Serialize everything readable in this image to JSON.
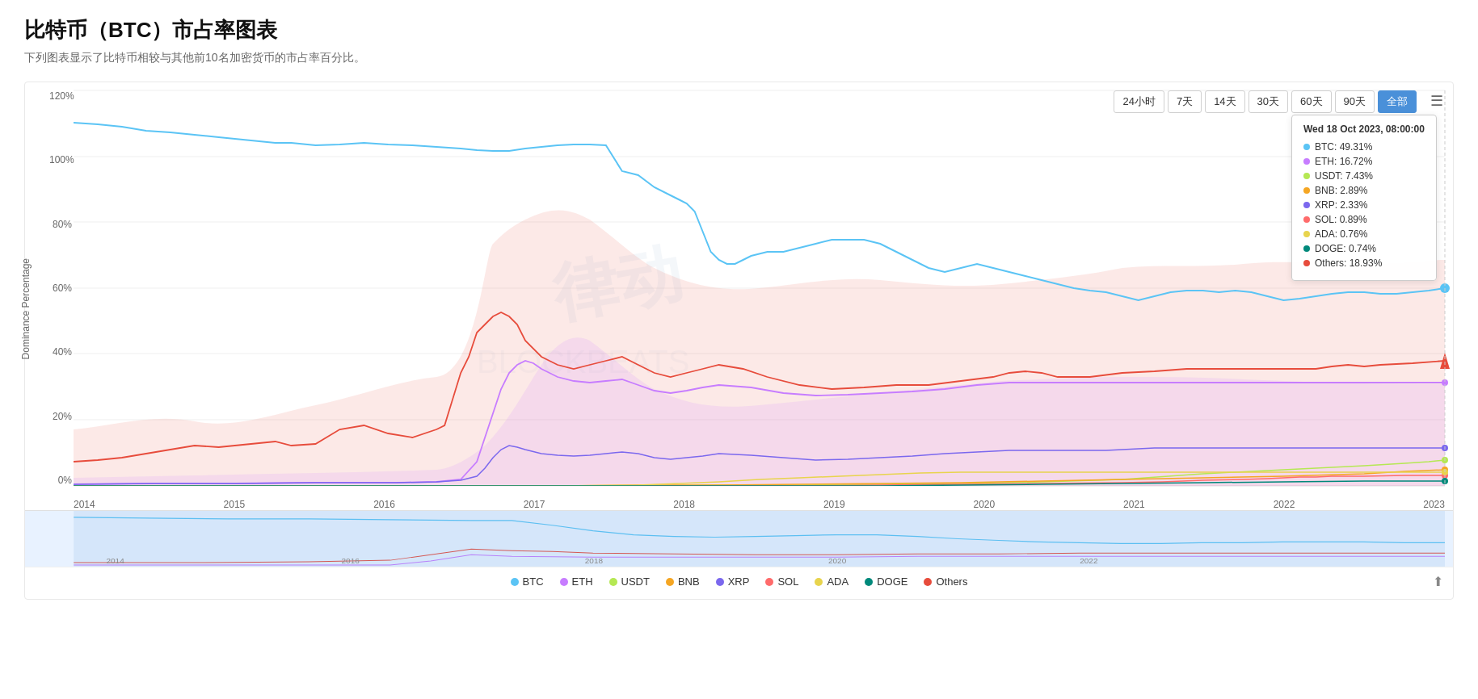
{
  "page": {
    "title": "比特币（BTC）市占率图表",
    "subtitle": "下列图表显示了比特币相较与其他前10名加密货币的市占率百分比。"
  },
  "timeButtons": [
    {
      "label": "24小时",
      "active": false
    },
    {
      "label": "7天",
      "active": false
    },
    {
      "label": "14天",
      "active": false
    },
    {
      "label": "30天",
      "active": false
    },
    {
      "label": "60天",
      "active": false
    },
    {
      "label": "90天",
      "active": false
    },
    {
      "label": "全部",
      "active": true
    }
  ],
  "chart": {
    "yAxisLabel": "Dominance Percentage",
    "yTicks": [
      "0%",
      "20%",
      "40%",
      "60%",
      "80%",
      "100%",
      "120%"
    ],
    "xTicks": [
      "2014",
      "2015",
      "2016",
      "2017",
      "2018",
      "2019",
      "2020",
      "2021",
      "2022",
      "2023"
    ]
  },
  "tooltip": {
    "title": "Wed 18 Oct 2023, 08:00:00",
    "rows": [
      {
        "label": "BTC: 49.31%",
        "color": "#5bc4f5"
      },
      {
        "label": "ETH: 16.72%",
        "color": "#c77dff"
      },
      {
        "label": "USDT: 7.43%",
        "color": "#b5e853"
      },
      {
        "label": "BNB: 2.89%",
        "color": "#f5a623"
      },
      {
        "label": "XRP: 2.33%",
        "color": "#7b68ee"
      },
      {
        "label": "SOL: 0.89%",
        "color": "#ff6b6b"
      },
      {
        "label": "ADA: 0.76%",
        "color": "#e8d44d"
      },
      {
        "label": "DOGE: 0.74%",
        "color": "#00897b"
      },
      {
        "label": "Others: 18.93%",
        "color": "#e74c3c"
      }
    ]
  },
  "legend": [
    {
      "label": "BTC",
      "color": "#5bc4f5"
    },
    {
      "label": "ETH",
      "color": "#c77dff"
    },
    {
      "label": "USDT",
      "color": "#b5e853"
    },
    {
      "label": "BNB",
      "color": "#f5a623"
    },
    {
      "label": "XRP",
      "color": "#7b68ee"
    },
    {
      "label": "SOL",
      "color": "#ff6b6b"
    },
    {
      "label": "ADA",
      "color": "#e8d44d"
    },
    {
      "label": "DOGE",
      "color": "#00897b"
    },
    {
      "label": "Others",
      "color": "#e74c3c"
    }
  ],
  "minimap": {
    "xTicks": [
      "2014",
      "2016",
      "2018",
      "2020",
      "2022"
    ]
  }
}
